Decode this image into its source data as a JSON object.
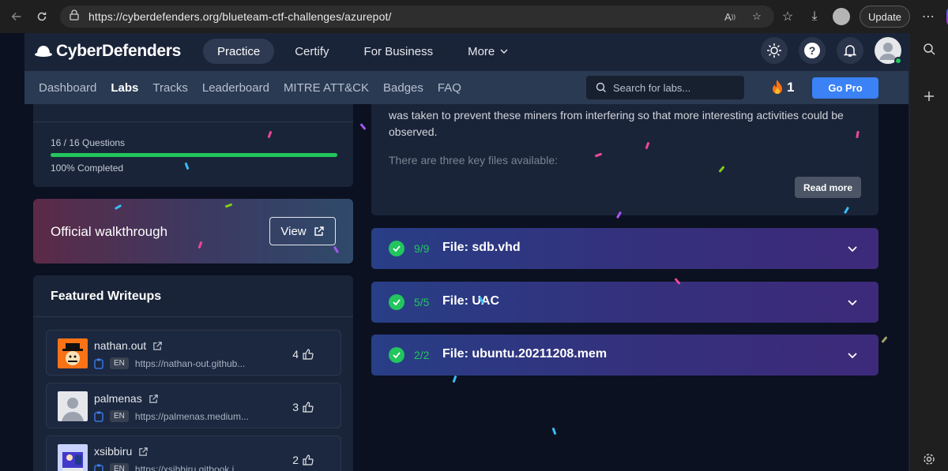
{
  "browser": {
    "url": "https://cyberdefenders.org/blueteam-ctf-challenges/azurepot/",
    "update_label": "Update"
  },
  "header": {
    "brand": "CyberDefenders",
    "nav": [
      {
        "label": "Practice",
        "active": true
      },
      {
        "label": "Certify"
      },
      {
        "label": "For Business"
      },
      {
        "label": "More"
      }
    ]
  },
  "subnav": {
    "tabs": [
      {
        "label": "Dashboard"
      },
      {
        "label": "Labs",
        "active": true
      },
      {
        "label": "Tracks"
      },
      {
        "label": "Leaderboard"
      },
      {
        "label": "MITRE ATT&CK"
      },
      {
        "label": "Badges"
      },
      {
        "label": "FAQ"
      }
    ],
    "search_placeholder": "Search for labs...",
    "streak": "1",
    "go_pro": "Go Pro"
  },
  "progress": {
    "questions": "16 / 16 Questions",
    "completed": "100% Completed",
    "fraction": 1.0
  },
  "walkthrough": {
    "title": "Official walkthrough",
    "view_label": "View"
  },
  "writeups": {
    "title": "Featured Writeups",
    "items": [
      {
        "name": "nathan.out",
        "lang": "EN",
        "link": "https://nathan-out.github...",
        "likes": "4"
      },
      {
        "name": "palmenas",
        "lang": "EN",
        "link": "https://palmenas.medium...",
        "likes": "3"
      },
      {
        "name": "xsibbiru",
        "lang": "EN",
        "link": "https://xsibbiru.gitbook.i...",
        "likes": "2"
      }
    ]
  },
  "description": {
    "line1": "was taken to prevent these miners from interfering so that more interesting activities could be observed.",
    "line2": "There are three key files available:",
    "read_more": "Read more"
  },
  "files": [
    {
      "count": "9/9",
      "name": "File: sdb.vhd"
    },
    {
      "count": "5/5",
      "name": "File: UAC"
    },
    {
      "count": "2/2",
      "name": "File: ubuntu.20211208.mem"
    }
  ],
  "colors": {
    "accent": "#3b82f6",
    "success": "#22c55e",
    "header_bg": "#1a2438",
    "subnav_bg": "#2a3a52"
  }
}
